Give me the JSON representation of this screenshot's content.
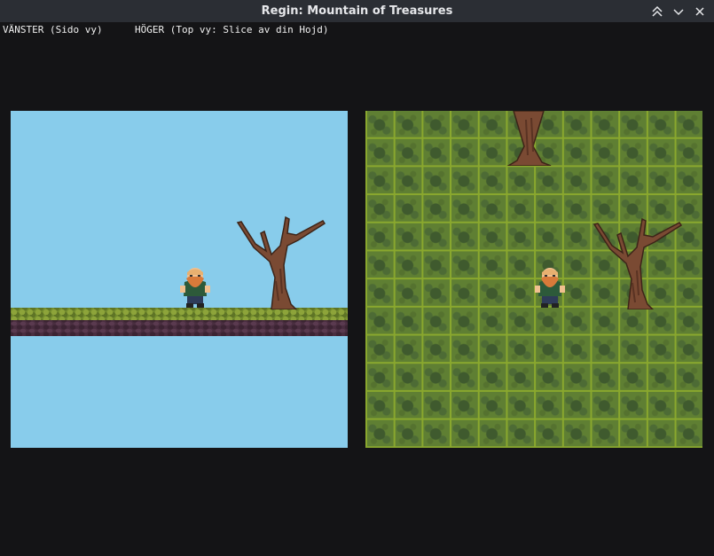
{
  "window": {
    "title": "Regin: Mountain of Treasures",
    "controls": [
      "maximize-icon",
      "minimize-icon",
      "close-icon"
    ]
  },
  "labels": {
    "left": "VÄNSTER (Sido vy)",
    "right": "HÖGER (Top vy: Slice av din Hojd)"
  },
  "colors": {
    "sky": "#88cceb",
    "grass": "#728c2e",
    "dirt": "#4a2e40",
    "tile_ground": "#6b8a2a",
    "background": "#141416"
  },
  "scene": {
    "left_view": {
      "entities": [
        "dwarf-character",
        "dead-tree"
      ]
    },
    "right_view": {
      "entities": [
        "dwarf-character",
        "dead-tree",
        "dead-tree-stump"
      ]
    }
  }
}
